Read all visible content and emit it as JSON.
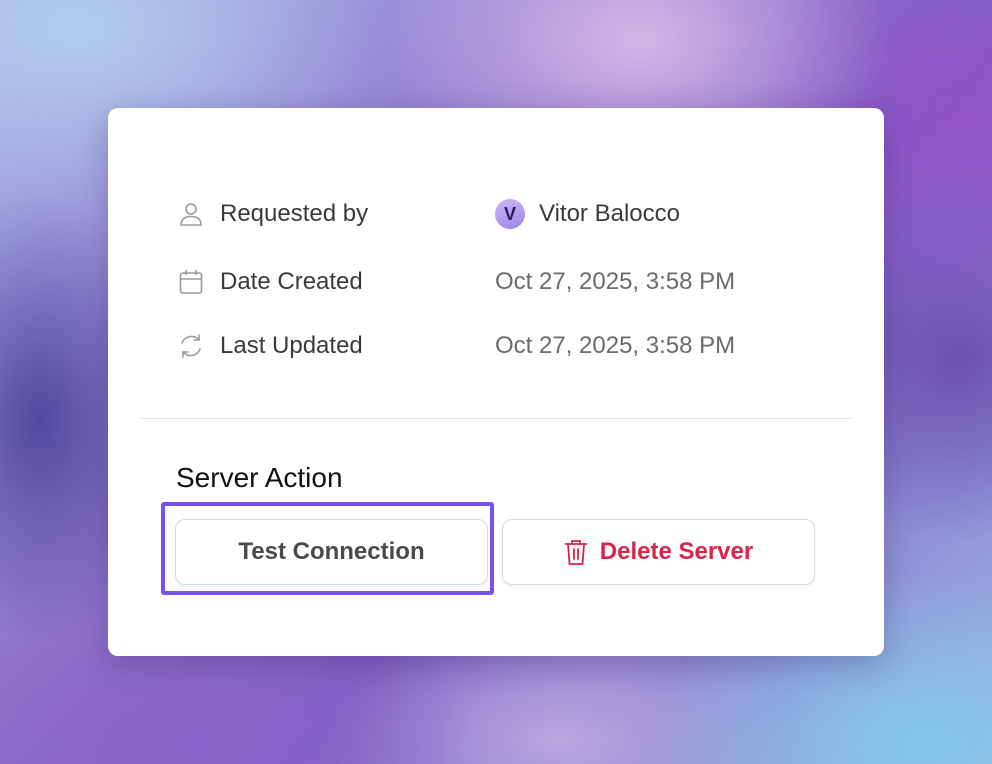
{
  "details": {
    "requested_by": {
      "icon": "user-icon",
      "label": "Requested by",
      "avatar_initial": "V",
      "value": "Vitor Balocco"
    },
    "date_created": {
      "icon": "calendar-icon",
      "label": "Date Created",
      "value": "Oct 27, 2025, 3:58 PM"
    },
    "last_updated": {
      "icon": "refresh-icon",
      "label": "Last Updated",
      "value": "Oct 27, 2025, 3:58 PM"
    }
  },
  "server_action": {
    "title": "Server Action",
    "test_label": "Test Connection",
    "delete_label": "Delete Server",
    "delete_icon": "trash-icon"
  },
  "colors": {
    "highlight": "#7b4ff0",
    "danger": "#d7264a",
    "avatar": "#9d84ea"
  }
}
